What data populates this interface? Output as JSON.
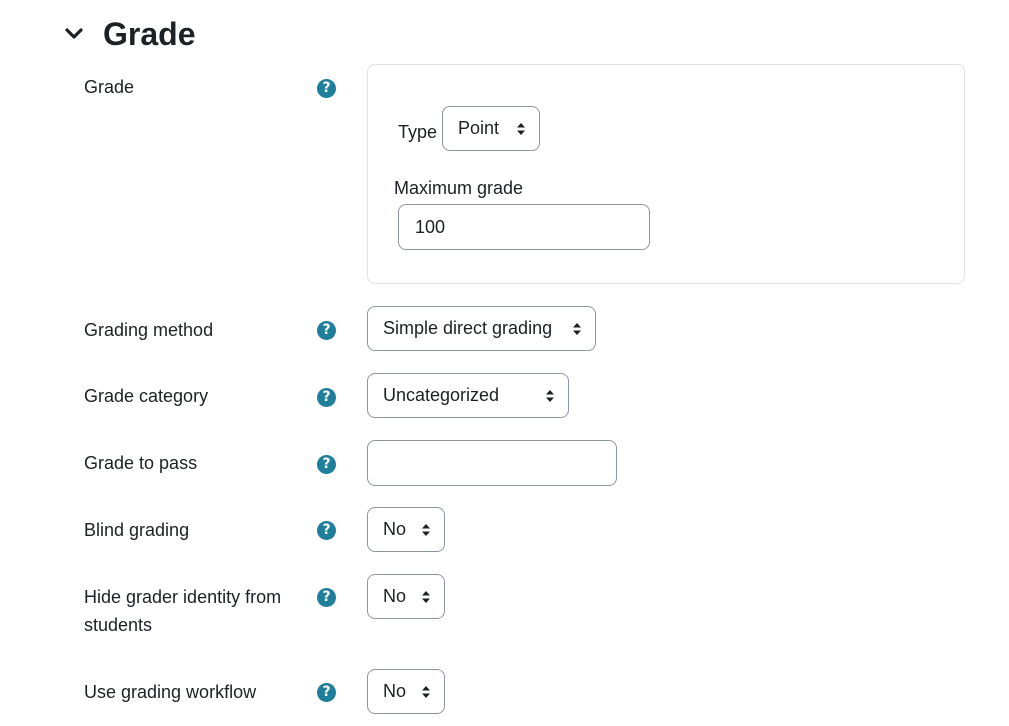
{
  "section": {
    "title": "Grade",
    "collapse_icon": "chevron-down-icon"
  },
  "help_icon": {
    "glyph": "?",
    "name": "question-circle-icon",
    "color": "#1f7e9a"
  },
  "fields": {
    "grade": {
      "label": "Grade",
      "type_label": "Type",
      "type_value": "Point",
      "max_grade_label": "Maximum grade",
      "max_grade_value": "100"
    },
    "grading_method": {
      "label": "Grading method",
      "value": "Simple direct grading"
    },
    "grade_category": {
      "label": "Grade category",
      "value": "Uncategorized"
    },
    "grade_to_pass": {
      "label": "Grade to pass",
      "value": ""
    },
    "blind_grading": {
      "label": "Blind grading",
      "value": "No"
    },
    "hide_grader": {
      "label": "Hide grader identity from students",
      "value": "No"
    },
    "grading_workflow": {
      "label": "Use grading workflow",
      "value": "No"
    }
  }
}
